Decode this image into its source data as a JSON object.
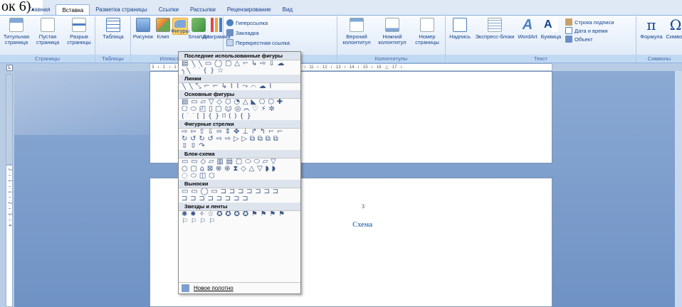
{
  "tabs": [
    "Главная",
    "Вставка",
    "Разметка страницы",
    "Ссылки",
    "Рассылки",
    "Рецензирование",
    "Вид"
  ],
  "overlay_text": "ок 6).",
  "groups": {
    "pages": {
      "label": "Страницы",
      "buttons": [
        "Титульная страница",
        "Пустая страница",
        "Разрыв страницы"
      ]
    },
    "tables": {
      "label": "Таблицы",
      "button": "Таблица"
    },
    "illustrations": {
      "label": "Иллюстрации",
      "buttons": [
        "Рисунок",
        "Клип",
        "Фигуры",
        "SmartArt",
        "Диаграмма"
      ]
    },
    "links": {
      "label": "Связи",
      "buttons": [
        "Гиперссылка",
        "Закладка",
        "Перекрестная ссылка"
      ]
    },
    "headers": {
      "label": "Колонтитулы",
      "buttons": [
        "Верхний колонтитул",
        "Нижний колонтитул",
        "Номер страницы"
      ]
    },
    "text": {
      "label": "Текст",
      "buttons": [
        "Надпись",
        "Экспресс-блоки",
        "WordArt",
        "Буквица"
      ],
      "small": [
        "Строка подписи",
        "Дата и время",
        "Объект"
      ]
    },
    "symbols": {
      "label": "Символы",
      "buttons": [
        "Формула",
        "Символ"
      ]
    }
  },
  "ruler_h_text": "3 · ı · 2 · ı · 1 · ı · · · ı · 1 · ı · 2 · ı · 3 · ı · 4 · ı · 5 · ı · 6 · ı · 7 · ı · 8 · ı · 9 · ı · 10 · ı · 11 · ı · 12 · ı · 13 · ı · 14 · ı · 15 · ı · 16 · △ · 17 · ı ·",
  "ruler_corner": "L",
  "ruler_v_text": "2 · ı · 1 · ı · 1 · ı · 2 · ı · 3 · ı · 4",
  "page": {
    "number": "3",
    "heading": "Схема"
  },
  "dropdown": {
    "sections": [
      {
        "title": "Последние использованные фигуры",
        "rows": [
          "▤ ╲ ╲ ▭ ◯ ▢ △ ⌐ ↳ ⇨ ⇩ ☁",
          "╮╲ ⌒ { } ☆"
        ]
      },
      {
        "title": "Линии",
        "rows": [
          "╲ ╲ ⤡ ⌐ ⌐ ↳ ⌇ ⌇ ⤳ ⌒ ☁ ⌇"
        ]
      },
      {
        "title": "Основные фигуры",
        "rows": [
          "▤ ▭ ▱ ▽ ◇ ⬡ ◔ △ ◣ ⬠ ⬡ ✚",
          "⬠ ⬭ ◰ ▯ ▢ ☺ ◎ ⌒ ♡ ⚡ ✲",
          "( ⌒ [ ] { } ⌑ ( ) { }"
        ]
      },
      {
        "title": "Фигурные стрелки",
        "rows": [
          "⇨ ⇦ ⇧ ⇩ ⬄ ⇕ ✥ ⊥ ↱ ↰ ⌐ ⌐",
          "↻ ↺ ↻ ↺ ⇨ ⇨ ▷ ▷ ⧉ ⧉ ⧉ ⧉",
          "⇳ ⇳ ↷"
        ]
      },
      {
        "title": "Блок-схема",
        "rows": [
          "▭ ▭ ◇ ▱ ▥ ▤ ▢ ⬭ ⬭ ▱ ▽",
          "○ ▢ ⌂ ⊠ ⊗ ⊕ ⧗ ◇ △ ▽ ◗ ◗",
          "◌ ⬭ ◫ ⬡"
        ]
      },
      {
        "title": "Выноски",
        "rows": [
          "▭ ▭ ◯ ▭ ⊐ ⊐ ⊐ ⊐ ⊐ ⊐ ⊐",
          "⊐ ⊐ ⊐ ⊐ ⊐ ⊐ ⊐ ⊐"
        ]
      },
      {
        "title": "Звезды и ленты",
        "rows": [
          "✺ ✹ ✧ ☆ ✪ ✪ ✪ ✪ ⚑ ⚑ ⚑ ⚑",
          "⚐ ⚐ ⚐ ⚐"
        ]
      }
    ],
    "footer": "Новое полотно"
  },
  "colors": {
    "accent": "#4f81bd",
    "ribbon": "#dbe7f7",
    "highlight": "#ffd36a"
  }
}
